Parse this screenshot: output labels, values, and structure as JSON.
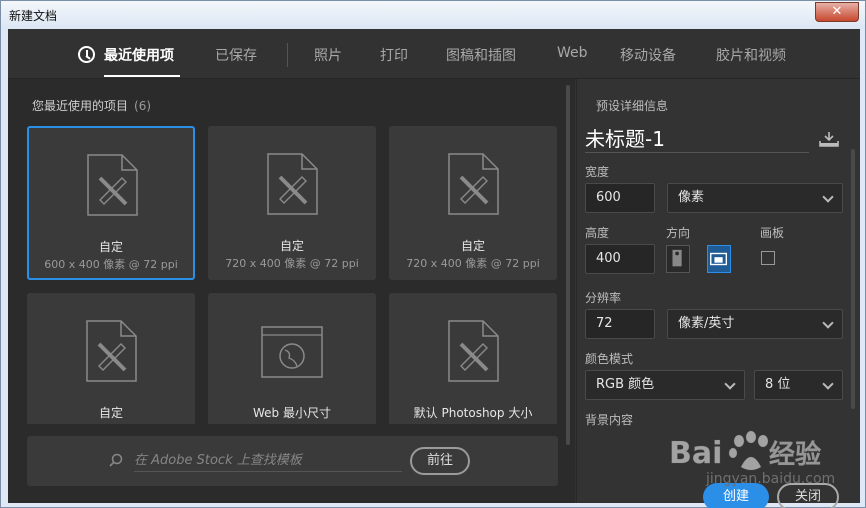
{
  "window": {
    "title": "新建文档",
    "close_glyph": "✕"
  },
  "tabs": [
    {
      "label": "最近使用项",
      "active": true
    },
    {
      "label": "已保存"
    },
    {
      "label": "照片"
    },
    {
      "label": "打印"
    },
    {
      "label": "图稿和插图"
    },
    {
      "label": "Web"
    },
    {
      "label": "移动设备"
    },
    {
      "label": "胶片和视频"
    }
  ],
  "recent": {
    "heading": "您最近使用的项目",
    "count": "(6)",
    "items": [
      {
        "name": "自定",
        "sub": "600 x 400 像素 @ 72 ppi",
        "icon": "document-ruler-pencil-icon",
        "selected": true
      },
      {
        "name": "自定",
        "sub": "720 x 400 像素 @ 72 ppi",
        "icon": "document-ruler-pencil-icon"
      },
      {
        "name": "自定",
        "sub": "720 x 400 像素 @ 72 ppi",
        "icon": "document-ruler-pencil-icon"
      },
      {
        "name": "自定",
        "sub": "",
        "icon": "document-ruler-pencil-icon"
      },
      {
        "name": "Web 最小尺寸",
        "sub": "",
        "icon": "web-globe-icon"
      },
      {
        "name": "默认 Photoshop 大小",
        "sub": "",
        "icon": "document-ruler-pencil-icon"
      }
    ]
  },
  "search": {
    "placeholder": "在 Adobe Stock 上查找模板",
    "go_label": "前往"
  },
  "preset": {
    "heading": "预设详细信息",
    "doc_title": "未标题-1",
    "width_label": "宽度",
    "width_value": "600",
    "width_unit": "像素",
    "height_label": "高度",
    "height_value": "400",
    "orientation_label": "方向",
    "artboard_label": "画板",
    "resolution_label": "分辨率",
    "resolution_value": "72",
    "resolution_unit": "像素/英寸",
    "color_mode_label": "颜色模式",
    "color_mode_value": "RGB 颜色",
    "bit_depth_value": "8 位",
    "background_label": "背景内容",
    "create_label": "创建",
    "close_label": "关闭"
  },
  "watermark": {
    "url": "jingyan.baidu.com",
    "brand": "Baidu 经验"
  },
  "colors": {
    "accent": "#2b8fe8",
    "panel": "#323232",
    "card": "#3a3a3a"
  }
}
